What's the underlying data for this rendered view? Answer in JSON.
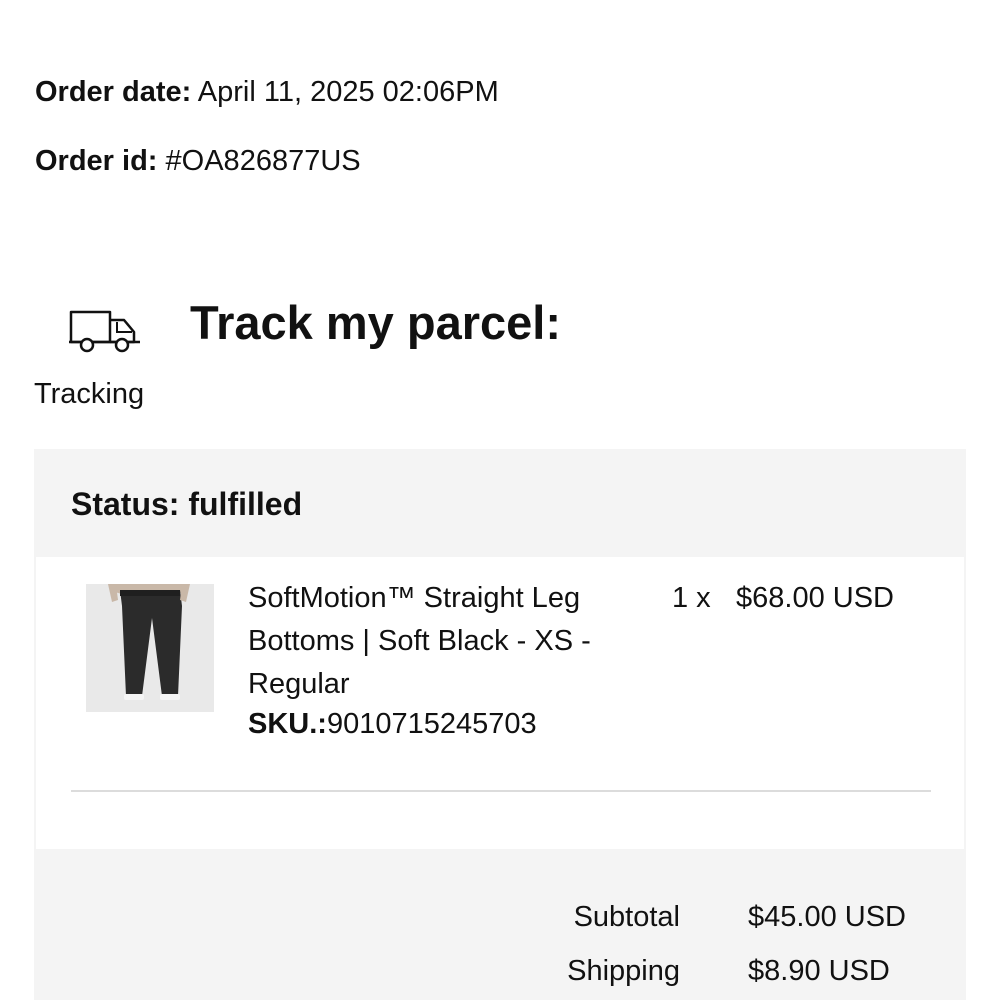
{
  "order": {
    "date_label": "Order date:",
    "date_value": "April 11, 2025 02:06PM",
    "id_label": "Order id:",
    "id_value": "#OA826877US"
  },
  "tracking": {
    "title": "Track my parcel:",
    "link_label": "Tracking",
    "icon": "truck-icon"
  },
  "status": {
    "text": "Status: fulfilled"
  },
  "item": {
    "name": "SoftMotion™ Straight Leg Bottoms | Soft Black - XS - Regular",
    "sku_label": "SKU.:",
    "sku_value": "9010715245703",
    "quantity": "1 x",
    "price": "$68.00 USD",
    "image": "product-thumbnail-black-pants"
  },
  "totals": {
    "subtotal_label": "Subtotal",
    "subtotal_value": "$45.00 USD",
    "shipping_label": "Shipping",
    "shipping_value": "$8.90 USD"
  },
  "colors": {
    "panel_background": "#f4f4f4",
    "text": "#111111",
    "divider": "#dcdcdc"
  }
}
